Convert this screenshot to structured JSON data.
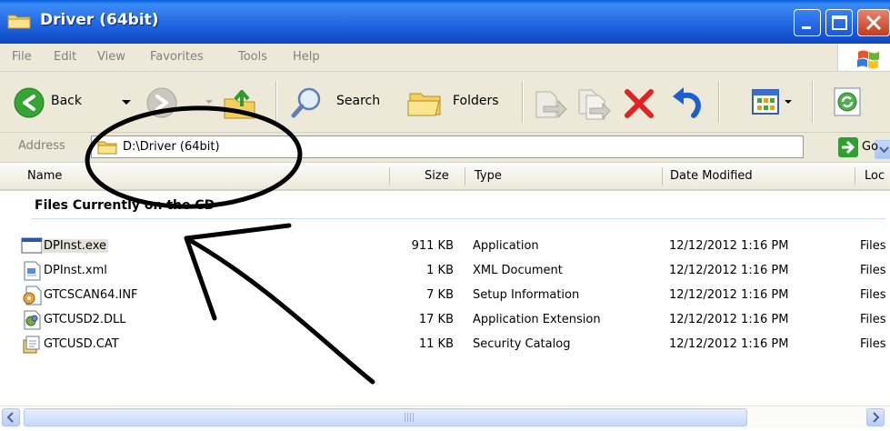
{
  "window": {
    "title": "Driver (64bit)",
    "buttons": {
      "minimize": "minimize",
      "maximize": "maximize",
      "close": "close"
    }
  },
  "menu": [
    "File",
    "Edit",
    "View",
    "Favorites",
    "Tools",
    "Help"
  ],
  "toolbar": {
    "back_label": "Back",
    "search_label": "Search",
    "folders_label": "Folders"
  },
  "address": {
    "label": "Address",
    "value": "D:\\Driver (64bit)",
    "go_label": "Go"
  },
  "columns": [
    "Name",
    "Size",
    "Type",
    "Date Modified",
    "Loc"
  ],
  "group": {
    "name": "Files Currently on the CD"
  },
  "files": [
    {
      "name": "DPInst.exe",
      "size": "911 KB",
      "type": "Application",
      "date": "12/12/2012 1:16 PM",
      "location": "Files",
      "icon": "exe-icon"
    },
    {
      "name": "DPInst.xml",
      "size": "1 KB",
      "type": "XML Document",
      "date": "12/12/2012 1:16 PM",
      "location": "Files",
      "icon": "xml-icon"
    },
    {
      "name": "GTCSCAN64.INF",
      "size": "7 KB",
      "type": "Setup Information",
      "date": "12/12/2012 1:16 PM",
      "location": "Files",
      "icon": "inf-icon"
    },
    {
      "name": "GTCUSD2.DLL",
      "size": "17 KB",
      "type": "Application Extension",
      "date": "12/12/2012 1:16 PM",
      "location": "Files",
      "icon": "dll-icon"
    },
    {
      "name": "GTCUSD.CAT",
      "size": "11 KB",
      "type": "Security Catalog",
      "date": "12/12/2012 1:16 PM",
      "location": "Files",
      "icon": "cat-icon"
    }
  ],
  "colors": {
    "titlebar": "#2a6fe6",
    "chrome": "#ece9d8",
    "close_button": "#c23d1c",
    "annotation": "#000000"
  }
}
